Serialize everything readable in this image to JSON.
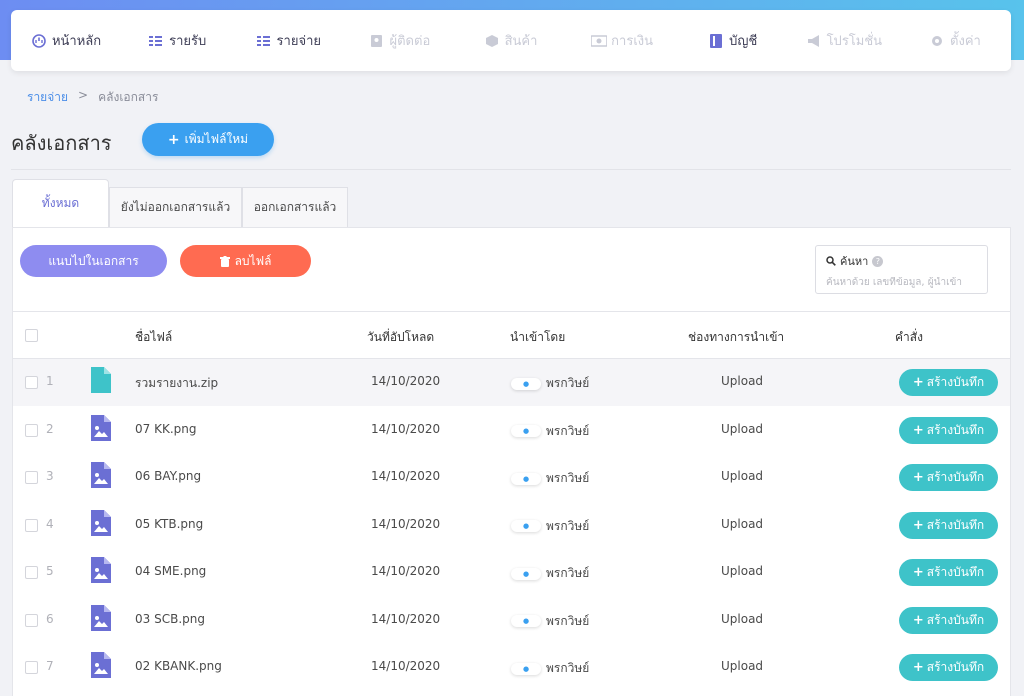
{
  "nav": [
    {
      "label": "หน้าหลัก",
      "icon": "gauge-icon",
      "disabled": false
    },
    {
      "label": "รายรับ",
      "icon": "income-icon",
      "disabled": false
    },
    {
      "label": "รายจ่าย",
      "icon": "expense-icon",
      "disabled": false
    },
    {
      "label": "ผู้ติดต่อ",
      "icon": "contact-icon",
      "disabled": true
    },
    {
      "label": "สินค้า",
      "icon": "box-icon",
      "disabled": true
    },
    {
      "label": "การเงิน",
      "icon": "money-icon",
      "disabled": true
    },
    {
      "label": "บัญชี",
      "icon": "ledger-icon",
      "disabled": false
    },
    {
      "label": "โปรโมชั่น",
      "icon": "megaphone-icon",
      "disabled": true
    },
    {
      "label": "ตั้งค่า",
      "icon": "gear-icon",
      "disabled": true
    }
  ],
  "breadcrumb": {
    "parent": "รายจ่าย",
    "separator": ">",
    "current": "คลังเอกสาร"
  },
  "page": {
    "title": "คลังเอกสาร",
    "add_button": "เพิ่มไฟล์ใหม่"
  },
  "tabs": [
    "ทั้งหมด",
    "ยังไม่ออกเอกสารแล้ว",
    "ออกเอกสารแล้ว"
  ],
  "toolbar": {
    "attach_label": "แนบไปในเอกสาร",
    "delete_label": "ลบไฟล์"
  },
  "search": {
    "label": "ค้นหา",
    "help": "?",
    "placeholder": "ค้นหาด้วย เลขที่ข้อมูล, ผู้นำเข้า"
  },
  "table": {
    "headers": {
      "name": "ชื่อไฟล์",
      "date": "วันที่อัปโหลด",
      "by": "นำเข้าโดย",
      "channel": "ช่องทางการนำเข้า",
      "action": "คำสั่ง"
    },
    "action_label": "สร้างบันทึก",
    "rows": [
      {
        "num": "1",
        "type": "zip",
        "name": "รวมรายงาน.zip",
        "date": "14/10/2020",
        "by": "พรกวิษย์",
        "channel": "Upload"
      },
      {
        "num": "2",
        "type": "image",
        "name": "07 KK.png",
        "date": "14/10/2020",
        "by": "พรกวิษย์",
        "channel": "Upload"
      },
      {
        "num": "3",
        "type": "image",
        "name": "06 BAY.png",
        "date": "14/10/2020",
        "by": "พรกวิษย์",
        "channel": "Upload"
      },
      {
        "num": "4",
        "type": "image",
        "name": "05 KTB.png",
        "date": "14/10/2020",
        "by": "พรกวิษย์",
        "channel": "Upload"
      },
      {
        "num": "5",
        "type": "image",
        "name": "04 SME.png",
        "date": "14/10/2020",
        "by": "พรกวิษย์",
        "channel": "Upload"
      },
      {
        "num": "6",
        "type": "image",
        "name": "03 SCB.png",
        "date": "14/10/2020",
        "by": "พรกวิษย์",
        "channel": "Upload"
      },
      {
        "num": "7",
        "type": "image",
        "name": "02 KBANK.png",
        "date": "14/10/2020",
        "by": "พรกวิษย์",
        "channel": "Upload"
      }
    ]
  },
  "colors": {
    "accent": "#6b6fd4",
    "primary": "#3aa0f0",
    "danger": "#ff6b51",
    "teal": "#3ec3c9"
  }
}
